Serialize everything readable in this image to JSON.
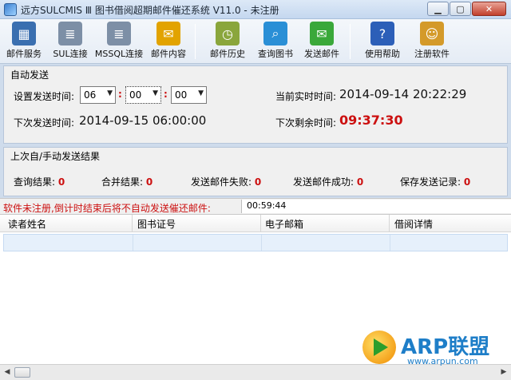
{
  "window": {
    "title": "远方SULCMIS Ⅲ 图书借阅超期邮件催还系统 V11.0 - 未注册",
    "min_label": "▁",
    "max_label": "▢",
    "close_label": "✕"
  },
  "toolbar": {
    "items": [
      {
        "label": "邮件服务",
        "icon": "server-icon",
        "color": "#3a6fb0",
        "glyph": "▦"
      },
      {
        "label": "SUL连接",
        "icon": "database-icon",
        "color": "#7d8fa6",
        "glyph": "≣"
      },
      {
        "label": "MSSQL连接",
        "icon": "database-icon",
        "color": "#7d8fa6",
        "glyph": "≣"
      },
      {
        "label": "邮件内容",
        "icon": "envelope-icon",
        "color": "#e2a300",
        "glyph": "✉"
      },
      {
        "label": "邮件历史",
        "icon": "clock-icon",
        "color": "#8aa63c",
        "glyph": "◷"
      },
      {
        "label": "查询图书",
        "icon": "magnifier-icon",
        "color": "#2a8fd6",
        "glyph": "⌕"
      },
      {
        "label": "发送邮件",
        "icon": "send-mail-icon",
        "color": "#3aa83a",
        "glyph": "✉"
      },
      {
        "label": "使用帮助",
        "icon": "help-book-icon",
        "color": "#2c5fb8",
        "glyph": "?"
      },
      {
        "label": "注册软件",
        "icon": "user-key-icon",
        "color": "#d49a2a",
        "glyph": "☺"
      }
    ]
  },
  "auto_send": {
    "title": "自动发送",
    "set_time_label": "设置发送时间:",
    "hour": "06",
    "minute": "00",
    "second": "00",
    "current_time_label": "当前实时时间:",
    "current_time": "2014-09-14 20:22:29",
    "next_send_label": "下次发送时间:",
    "next_send": "2014-09-15 06:00:00",
    "remaining_label": "下次剩余时间:",
    "remaining": "09:37:30"
  },
  "last_result": {
    "title": "上次自/手动发送结果",
    "query_label": "查询结果:",
    "query_value": "0",
    "merge_label": "合并结果:",
    "merge_value": "0",
    "fail_label": "发送邮件失败:",
    "fail_value": "0",
    "success_label": "发送邮件成功:",
    "success_value": "0",
    "save_label": "保存发送记录:",
    "save_value": "0"
  },
  "warning": {
    "text": "软件未注册,倒计时结束后将不自动发送催还邮件:",
    "countdown": "00:59:44"
  },
  "table": {
    "columns": [
      "读者姓名",
      "图书证号",
      "电子邮箱",
      "借阅详情"
    ]
  },
  "watermark": {
    "text": "ARP联盟",
    "url": "www.arpun.com"
  }
}
